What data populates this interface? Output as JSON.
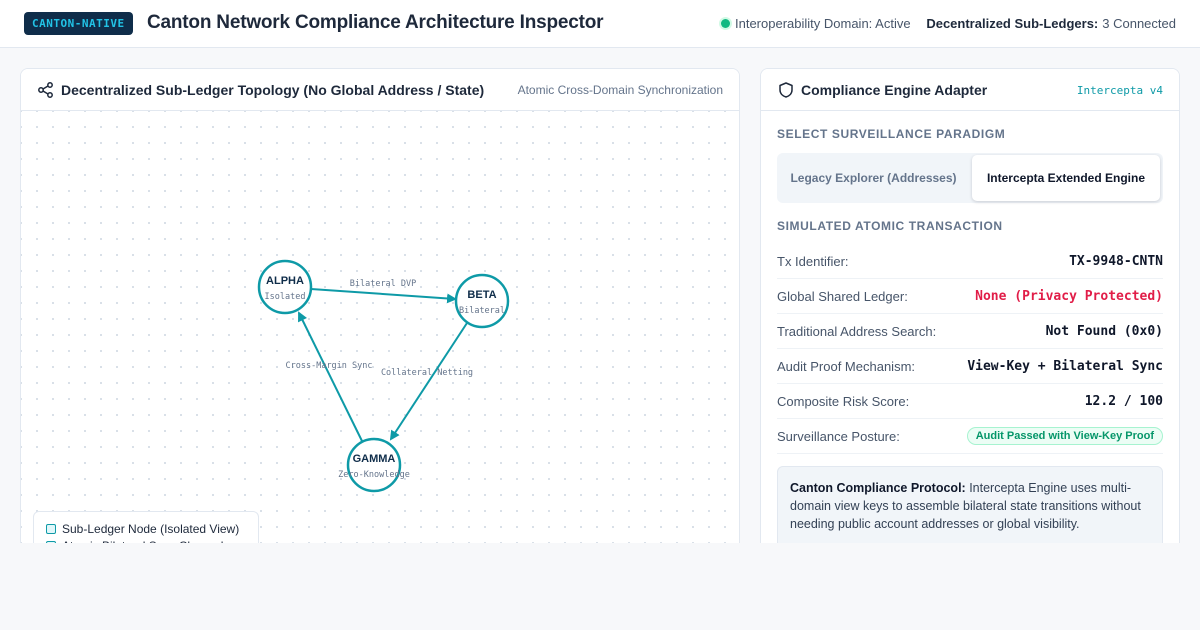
{
  "header": {
    "brand": "CANTON-NATIVE",
    "title": "Canton Network Compliance Architecture Inspector",
    "status_text": "Interoperability Domain: Active",
    "subledgers_label": "Decentralized Sub-Ledgers:",
    "subledgers_value": "3 Connected"
  },
  "topology": {
    "title": "Decentralized Sub-Ledger Topology (No Global Address / State)",
    "subtitle": "Atomic Cross-Domain Synchronization",
    "nodes": [
      {
        "name": "ALPHA",
        "role": "Isolated"
      },
      {
        "name": "BETA",
        "role": "Bilateral"
      },
      {
        "name": "GAMMA",
        "role": "Zero-Knowledge"
      }
    ],
    "edges": [
      {
        "from": "ALPHA",
        "to": "BETA",
        "label": "Bilateral DVP"
      },
      {
        "from": "BETA",
        "to": "GAMMA",
        "label": "Collateral Netting"
      },
      {
        "from": "GAMMA",
        "to": "ALPHA",
        "label": "Cross-Margin Sync"
      }
    ],
    "legend": {
      "node": "Sub-Ledger Node (Isolated View)",
      "channel": "Atomic Bilateral Sync Channel"
    }
  },
  "compliance": {
    "title": "Compliance Engine Adapter",
    "version": "Intercepta v4",
    "paradigm_label": "SELECT SURVEILLANCE PARADIGM",
    "options": {
      "legacy": "Legacy Explorer (Addresses)",
      "intercepta": "Intercepta Extended Engine"
    },
    "selected_option": "intercepta",
    "tx_label": "SIMULATED ATOMIC TRANSACTION",
    "tx": {
      "id_key": "Tx Identifier:",
      "id_val": "TX-9948-CNTN",
      "ledger_key": "Global Shared Ledger:",
      "ledger_val": "None (Privacy Protected)",
      "search_key": "Traditional Address Search:",
      "search_val": "Not Found (0x0)",
      "audit_key": "Audit Proof Mechanism:",
      "audit_val": "View-Key + Bilateral Sync",
      "risk_key": "Composite Risk Score:",
      "risk_val": "12.2 / 100",
      "posture_key": "Surveillance Posture:",
      "posture_val": "Audit Passed with View-Key Proof"
    },
    "protocol": {
      "title": "Canton Compliance Protocol:",
      "body": "Intercepta Engine uses multi-domain view keys to assemble bilateral state transitions without needing public account addresses or global visibility."
    }
  },
  "colors": {
    "accent": "#0e9aa7",
    "alert": "#e11d48",
    "success": "#059669",
    "brand_bg": "#0f2d4a"
  }
}
